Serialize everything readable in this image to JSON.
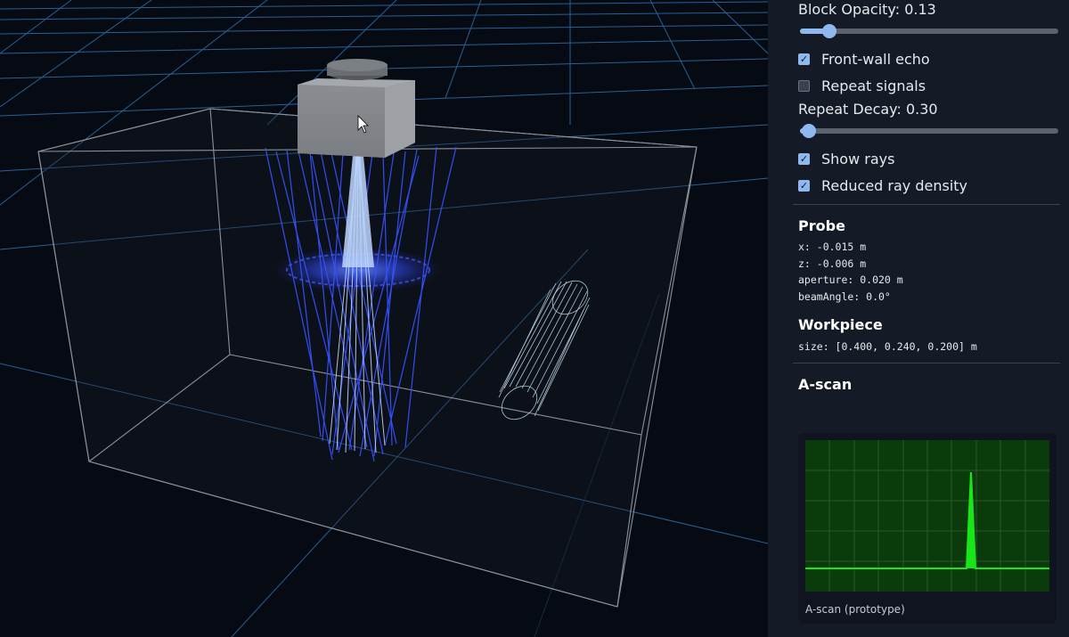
{
  "controls": {
    "block_opacity": {
      "label": "Block Opacity: 0.13",
      "value": 0.13
    },
    "front_wall_echo": {
      "label": "Front-wall echo",
      "checked": true
    },
    "repeat_signals": {
      "label": "Repeat signals",
      "checked": false
    },
    "repeat_decay": {
      "label": "Repeat Decay: 0.30",
      "value": 0.3
    },
    "show_rays": {
      "label": "Show rays",
      "checked": true
    },
    "reduced_ray_density": {
      "label": "Reduced ray density",
      "checked": true
    }
  },
  "probe": {
    "heading": "Probe",
    "x": "x: -0.015 m",
    "z": "z: -0.006 m",
    "aperture": "aperture: 0.020 m",
    "beam_angle": "beamAngle: 0.0°"
  },
  "workpiece": {
    "heading": "Workpiece",
    "size": "size: [0.400, 0.240, 0.200] m"
  },
  "ascan": {
    "heading": "A-scan",
    "caption": "A-scan (prototype)"
  },
  "colors": {
    "accent": "#8fb8ef",
    "ray": "#3a5cff",
    "ray_core": "#cfe0ff",
    "grid": "#3a7fc0",
    "trace": "#19e619",
    "plot_bg": "#0b3a0b"
  },
  "icons": {
    "checkbox_on": "✓"
  }
}
